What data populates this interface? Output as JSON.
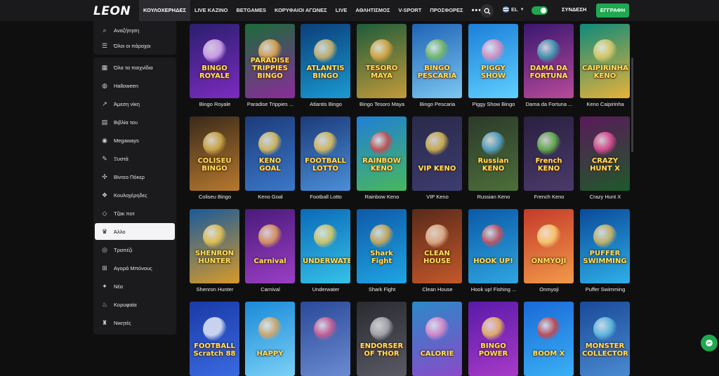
{
  "header": {
    "logo": "LEON",
    "nav": [
      "ΚΟΥΛΟΧΕΡΗΔΕΣ",
      "LIVE ΚΑΖΙΝΟ",
      "BETGAMES",
      "ΚΟΡΥΦΑΙΟΙ ΑΓΩΝΕΣ",
      "LIVE",
      "ΑΘΛΗΤΙΣΜΟΣ",
      "V-SPORT",
      "ΠΡΟΣΦΟΡΕΣ"
    ],
    "more_icon": "dots-horizontal-icon",
    "language": "EL",
    "login": "ΣΥΝΔΕΣΗ",
    "register": "ΕΓΓΡΑΦΗ"
  },
  "sidebar_top": [
    {
      "label": "Αναζήτηση",
      "icon": "search-icon"
    },
    {
      "label": "Όλοι οι πάροχοι",
      "icon": "sliders-icon"
    }
  ],
  "sidebar": [
    {
      "label": "Όλα τα παιχνίδια",
      "icon": "grid-icon"
    },
    {
      "label": "Halloween",
      "icon": "pumpkin-icon"
    },
    {
      "label": "Άμεση νίκη",
      "icon": "chart-icon"
    },
    {
      "label": "Βιβλία του",
      "icon": "book-icon"
    },
    {
      "label": "Megaways",
      "icon": "megaways-icon"
    },
    {
      "label": "Ξυστά",
      "icon": "scratch-icon"
    },
    {
      "label": "Βίντεο Πόκερ",
      "icon": "poker-icon"
    },
    {
      "label": "Κουλοχέρηδες",
      "icon": "slot-icon"
    },
    {
      "label": "Τζακ ποτ",
      "icon": "diamond-icon"
    },
    {
      "label": "Άλλο",
      "icon": "crown-icon"
    },
    {
      "label": "Τραπέζι",
      "icon": "table-icon"
    },
    {
      "label": "Αγορά Μπόνους",
      "icon": "cart-icon"
    },
    {
      "label": "Νέα",
      "icon": "new-icon"
    },
    {
      "label": "Κορυφαία",
      "icon": "fire-icon"
    },
    {
      "label": "Νικητές",
      "icon": "trophy-icon"
    }
  ],
  "active_sidebar_item": "Άλλο",
  "games": [
    {
      "name": "Bingo Royale",
      "art": "BINGO ROYALE",
      "c1": "#2a1f6e",
      "c2": "#7c2bbf",
      "orb": "#f0c0ff"
    },
    {
      "name": "Paradise Trippies ...",
      "art": "PARADISE TRIPPIES BINGO",
      "c1": "#1b6b3a",
      "c2": "#8b2c9b",
      "orb": "#ffb347"
    },
    {
      "name": "Atlantis Bingo",
      "art": "ATLANTIS BINGO",
      "c1": "#0b3f7a",
      "c2": "#1a9ad1",
      "orb": "#f3c45a"
    },
    {
      "name": "Bingo Tesoro Maya",
      "art": "TESORO MAYA",
      "c1": "#1d5c3a",
      "c2": "#c49a3a",
      "orb": "#f2b14a"
    },
    {
      "name": "Bingo Pescaria",
      "art": "BINGO PESCARIA",
      "c1": "#1f64b5",
      "c2": "#7dc7f2",
      "orb": "#7fc24a"
    },
    {
      "name": "Piggy Show Bingo",
      "art": "PIGGY SHOW",
      "c1": "#1c7fd8",
      "c2": "#5fd0ff",
      "orb": "#ff8ab5"
    },
    {
      "name": "Dama da Fortuna ...",
      "art": "DAMA DA FORTUNA",
      "c1": "#3a1770",
      "c2": "#b84a9a",
      "orb": "#2fb4b8"
    },
    {
      "name": "Keno Caipirinha",
      "art": "CAIPIRINHA KENO",
      "c1": "#0e8a7a",
      "c2": "#e8b23a",
      "orb": "#f5d36a"
    },
    {
      "name": "Coliseu Bingo",
      "art": "COLISEU BINGO",
      "c1": "#3a2a1a",
      "c2": "#b7792f",
      "orb": "#e2c050"
    },
    {
      "name": "Keno Goal",
      "art": "KENO GOAL",
      "c1": "#1d3b7a",
      "c2": "#3a78c9",
      "orb": "#ffd24a"
    },
    {
      "name": "Football Lotto",
      "art": "FOOTBALL LOTTO",
      "c1": "#1d3b7a",
      "c2": "#4a8fd9",
      "orb": "#ffd24a"
    },
    {
      "name": "Rainbow Keno",
      "art": "RAINBOW KENO",
      "c1": "#1f7fd6",
      "c2": "#49b85c",
      "orb": "#e53c3c"
    },
    {
      "name": "VIP Keno",
      "art": "VIP KENO",
      "c1": "#2a2a4a",
      "c2": "#3c3c70",
      "orb": "#f3d04a"
    },
    {
      "name": "Russian Keno",
      "art": "Russian KENO",
      "c1": "#2c3a2a",
      "c2": "#4c6f3a",
      "orb": "#5ab5e8"
    },
    {
      "name": "French Keno",
      "art": "French KENO",
      "c1": "#2a2040",
      "c2": "#4a3a6a",
      "orb": "#6ccf4a"
    },
    {
      "name": "Crazy Hunt X",
      "art": "CRAZY HUNT X",
      "c1": "#5a1a5a",
      "c2": "#1e5a2a",
      "orb": "#ff4fa3"
    },
    {
      "name": "Shenron Hunter",
      "art": "SHENRON HUNTER",
      "c1": "#1a5a9a",
      "c2": "#d79a2a",
      "orb": "#ffd24a"
    },
    {
      "name": "Carnival",
      "art": "Carnival",
      "c1": "#4a1a7a",
      "c2": "#9b3fc4",
      "orb": "#f2b14a"
    },
    {
      "name": "Underwater",
      "art": "UNDERWATER",
      "c1": "#0a6ab8",
      "c2": "#35c2e8",
      "orb": "#ffd24a"
    },
    {
      "name": "Shark Fight",
      "art": "Shark Fight",
      "c1": "#0d5aa8",
      "c2": "#1fa5e3",
      "orb": "#f4b23a"
    },
    {
      "name": "Clean House",
      "art": "CLEAN HOUSE",
      "c1": "#5a2a1a",
      "c2": "#c4582a",
      "orb": "#f2c9a0"
    },
    {
      "name": "Hook up! Fishing ...",
      "art": "HOOK UP!",
      "c1": "#0a5aa8",
      "c2": "#2fa6e0",
      "orb": "#e84a4a"
    },
    {
      "name": "Onmyoji",
      "art": "ONMYOJI",
      "c1": "#c43a2a",
      "c2": "#f29a4a",
      "orb": "#ffe07a"
    },
    {
      "name": "Puffer Swimming",
      "art": "PUFFER SWIMMING",
      "c1": "#0a4a9a",
      "c2": "#2fb0e8",
      "orb": "#f5c24a"
    },
    {
      "name": "",
      "art": "FOOTBALL Scratch 88",
      "c1": "#1a3aa8",
      "c2": "#3a6ae0",
      "orb": "#ffffff"
    },
    {
      "name": "",
      "art": "HAPPY",
      "c1": "#1a8ad8",
      "c2": "#7ad0f5",
      "orb": "#f5a54a"
    },
    {
      "name": "",
      "art": "",
      "c1": "#2a4a9a",
      "c2": "#6a8ad0",
      "orb": "#e85a8a"
    },
    {
      "name": "",
      "art": "ENDORSER OF THOR",
      "c1": "#2a2a30",
      "c2": "#5a5a66",
      "orb": "#c0c0c8"
    },
    {
      "name": "",
      "art": "CALORIE",
      "c1": "#2a8ac8",
      "c2": "#8a4ac8",
      "orb": "#f58ac8"
    },
    {
      "name": "",
      "art": "BINGO POWER",
      "c1": "#5a1aa8",
      "c2": "#a83ac8",
      "orb": "#ffd24a"
    },
    {
      "name": "",
      "art": "BOOM X",
      "c1": "#1a6ad8",
      "c2": "#3ab0f5",
      "orb": "#e83a2a"
    },
    {
      "name": "",
      "art": "MONSTER COLLECTOR",
      "c1": "#1a4a9a",
      "c2": "#4a8ad0",
      "orb": "#6ad0e8"
    }
  ],
  "chat_icon": "chat-icon",
  "colors": {
    "accent": "#1fa850",
    "bg": "#0f0f10",
    "panel": "#1b1b1e"
  }
}
